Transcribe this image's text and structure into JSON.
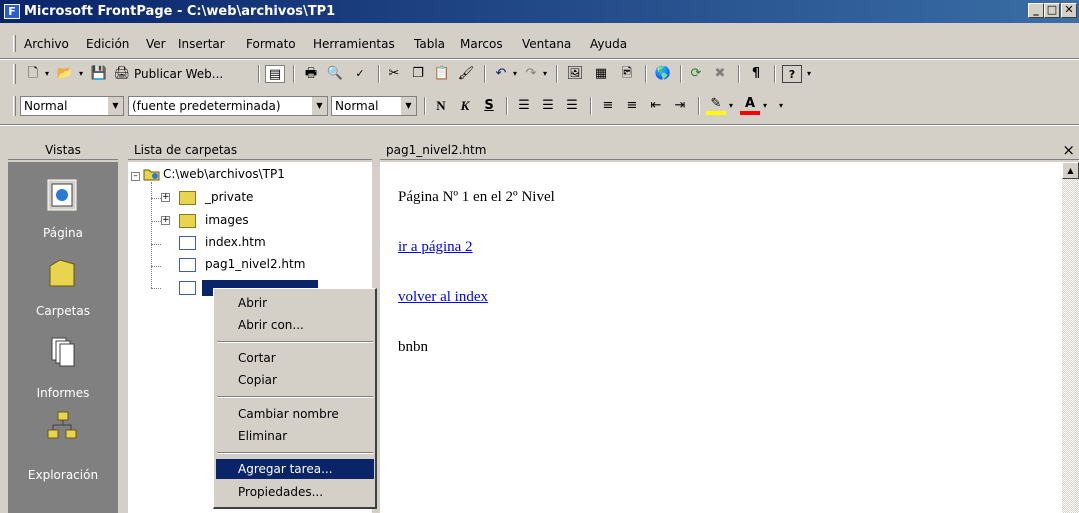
{
  "window": {
    "title": "Microsoft FrontPage - C:\\web\\archivos\\TP1",
    "controls": {
      "minimize": "_",
      "maximize": "□",
      "close": "✕"
    }
  },
  "menubar": {
    "items": [
      "Archivo",
      "Edición",
      "Ver",
      "Insertar",
      "Formato",
      "Herramientas",
      "Tabla",
      "Marcos",
      "Ventana",
      "Ayuda"
    ]
  },
  "toolbar": {
    "publish_label": "Publicar Web...",
    "icons": [
      "new-icon",
      "open-icon",
      "save-icon",
      "publish-icon",
      "folder-list-icon",
      "print-icon",
      "print-preview-icon",
      "spelling-icon",
      "cut-icon",
      "copy-icon",
      "paste-icon",
      "format-painter-icon",
      "undo-icon",
      "redo-icon",
      "insert-component-icon",
      "insert-table-icon",
      "insert-picture-icon",
      "hyperlink-icon",
      "refresh-icon",
      "stop-icon",
      "show-all-icon",
      "help-icon"
    ]
  },
  "formatting": {
    "style_value": "Normal",
    "font_value": "(fuente predeterminada)",
    "size_value": "Normal",
    "bold_glyph": "N",
    "italic_glyph": "K",
    "underline_glyph": "S"
  },
  "views_pane": {
    "header": "Vistas",
    "items": [
      {
        "label": "Página",
        "icon": "page-view-icon"
      },
      {
        "label": "Carpetas",
        "icon": "folders-view-icon"
      },
      {
        "label": "Informes",
        "icon": "reports-view-icon"
      },
      {
        "label": "Exploración",
        "icon": "navigation-view-icon"
      }
    ]
  },
  "folder_pane": {
    "header": "Lista de carpetas",
    "root": "C:\\web\\archivos\\TP1",
    "nodes": [
      "_private",
      "images",
      "index.htm",
      "pag1_nivel2.htm"
    ]
  },
  "page_pane": {
    "tab": "pag1_nivel2.htm",
    "close_glyph": "×",
    "lines": {
      "heading": "Página Nº 1 en el 2º Nivel",
      "link1": "ir a página 2",
      "link2": "volver al index",
      "text": "bnbn"
    }
  },
  "context_menu": {
    "items": [
      "Abrir",
      "Abrir con...",
      "Cortar",
      "Copiar",
      "Cambiar nombre",
      "Eliminar",
      "Agregar tarea...",
      "Propiedades..."
    ],
    "highlighted": "Agregar tarea..."
  }
}
